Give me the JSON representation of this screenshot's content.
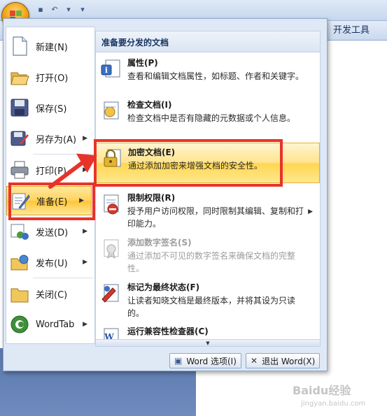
{
  "ribbon": {
    "developer_tab": "开发工具"
  },
  "quick_access": {
    "icons": [
      "save-icon",
      "undo-icon",
      "undo-dropdown-icon",
      "customize-icon"
    ]
  },
  "left_menu": {
    "items": [
      {
        "label": "新建(N)",
        "icon": "new-document-icon",
        "has_submenu": false
      },
      {
        "label": "打开(O)",
        "icon": "open-folder-icon",
        "has_submenu": false
      },
      {
        "label": "保存(S)",
        "icon": "save-disk-icon",
        "has_submenu": false
      },
      {
        "label": "另存为(A)",
        "icon": "save-as-icon",
        "has_submenu": true
      },
      {
        "label": "打印(P)",
        "icon": "printer-icon",
        "has_submenu": true
      },
      {
        "label": "准备(E)",
        "icon": "prepare-icon",
        "has_submenu": true,
        "selected": true
      },
      {
        "label": "发送(D)",
        "icon": "send-icon",
        "has_submenu": true
      },
      {
        "label": "发布(U)",
        "icon": "publish-icon",
        "has_submenu": true
      },
      {
        "label": "关闭(C)",
        "icon": "close-folder-icon",
        "has_submenu": false
      },
      {
        "label": "WordTab",
        "icon": "wordtab-icon",
        "has_submenu": true
      }
    ]
  },
  "submenu": {
    "header": "准备要分发的文档",
    "items": [
      {
        "title": "属性(P)",
        "desc": "查看和编辑文档属性，如标题、作者和关键字。",
        "icon": "properties-icon"
      },
      {
        "title": "检查文档(I)",
        "desc": "检查文档中是否有隐藏的元数据或个人信息。",
        "icon": "inspect-document-icon"
      },
      {
        "title": "加密文档(E)",
        "desc": "通过添加加密来增强文档的安全性。",
        "icon": "encrypt-document-icon",
        "highlighted": true
      },
      {
        "title": "限制权限(R)",
        "desc": "授予用户访问权限，同时限制其编辑、复制和打印能力。",
        "icon": "restrict-permission-icon",
        "has_submenu": true
      },
      {
        "title": "添加数字签名(S)",
        "desc": "通过添加不可见的数字签名来确保文档的完整性。",
        "icon": "digital-signature-icon",
        "disabled": true
      },
      {
        "title": "标记为最终状态(F)",
        "desc": "让读者知晓文档是最终版本，并将其设为只读的。",
        "icon": "mark-final-icon"
      },
      {
        "title": "运行兼容性检查器(C)",
        "desc": "",
        "icon": "compatibility-checker-icon"
      }
    ]
  },
  "bottom_buttons": {
    "word_options": "Word 选项(I)",
    "exit_word": "退出 Word(X)"
  },
  "watermark": {
    "text": "Baidu经验",
    "sub": "jingyan.baidu.com"
  },
  "colors": {
    "annotation": "#e8332a",
    "highlight": "#ffd64f",
    "office_orange": "#f0a010"
  }
}
